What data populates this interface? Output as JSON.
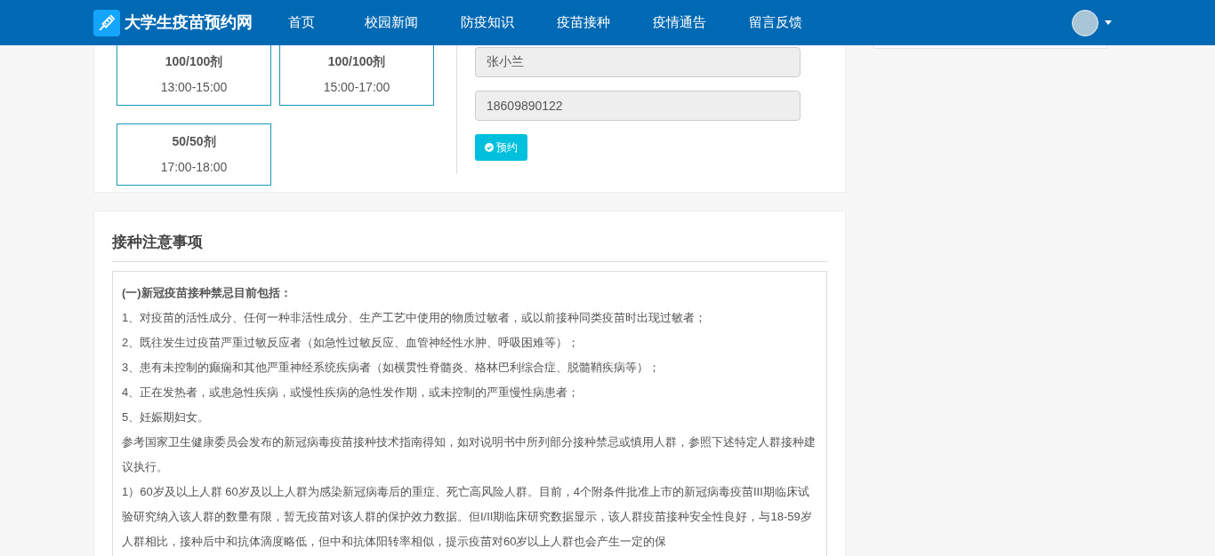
{
  "brand": {
    "title": "大学生疫苗预约网"
  },
  "nav": [
    {
      "label": "首页"
    },
    {
      "label": "校园新闻"
    },
    {
      "label": "防疫知识"
    },
    {
      "label": "疫苗接种"
    },
    {
      "label": "疫情通告"
    },
    {
      "label": "留言反馈"
    }
  ],
  "slots": [
    {
      "count": "100/100剂",
      "time": "13:00-15:00"
    },
    {
      "count": "100/100剂",
      "time": "15:00-17:00"
    },
    {
      "count": "50/50剂",
      "time": "17:00-18:00"
    }
  ],
  "form": {
    "fields": [
      {
        "value": "张小兰"
      },
      {
        "value": "18609890122"
      }
    ],
    "button": "预约"
  },
  "notice": {
    "title": "接种注意事项",
    "paragraphs": [
      {
        "kind": "heading",
        "text": "(一)新冠疫苗接种禁忌目前包括："
      },
      {
        "kind": "text",
        "text": "1、对疫苗的活性成分、任何一种非活性成分、生产工艺中使用的物质过敏者，或以前接种同类疫苗时出现过敏者；"
      },
      {
        "kind": "text",
        "text": "2、既往发生过疫苗严重过敏反应者（如急性过敏反应、血管神经性水肿、呼吸困难等）；"
      },
      {
        "kind": "text",
        "text": "3、患有未控制的癫痫和其他严重神经系统疾病者（如横贯性脊髓炎、格林巴利综合症、脱髓鞘疾病等）；"
      },
      {
        "kind": "text",
        "text": "4、正在发热者，或患急性疾病，或慢性疾病的急性发作期，或未控制的严重慢性病患者；"
      },
      {
        "kind": "text",
        "text": "5、妊娠期妇女。"
      },
      {
        "kind": "text",
        "text": "参考国家卫生健康委员会发布的新冠病毒疫苗接种技术指南得知，如对说明书中所列部分接种禁忌或慎用人群，参照下述特定人群接种建议执行。"
      },
      {
        "kind": "text",
        "text": "1）60岁及以上人群 60岁及以上人群为感染新冠病毒后的重症、死亡高风险人群。目前，4个附条件批准上市的新冠病毒疫苗III期临床试验研究纳入该人群的数量有限，暂无疫苗对该人群的保护效力数据。但I/II期临床研究数据显示，该人群疫苗接种安全性良好，与18-59岁人群相比，接种后中和抗体滴度略低，但中和抗体阳转率相似，提示疫苗对60岁以上人群也会产生一定的保"
      }
    ]
  }
}
